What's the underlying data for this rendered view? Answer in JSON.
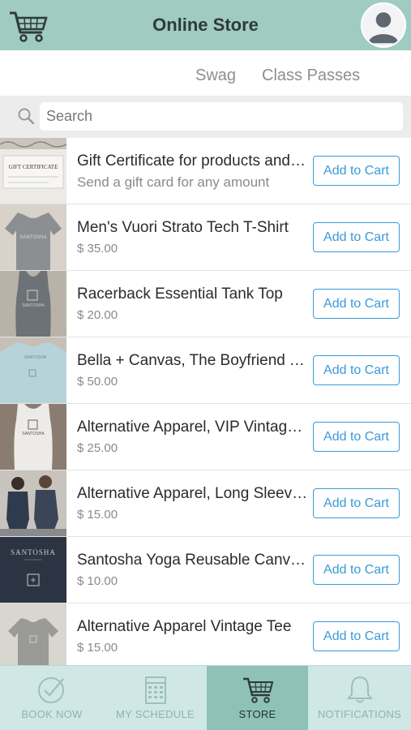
{
  "header": {
    "title": "Online Store",
    "cart_icon": "cart-icon",
    "avatar_icon": "user-avatar-icon"
  },
  "tabs": [
    {
      "label": "Swag"
    },
    {
      "label": "Class Passes"
    }
  ],
  "search": {
    "placeholder": "Search",
    "value": ""
  },
  "products": [
    {
      "name": "Gift Certificate for products and services",
      "subtitle": "Send a gift card for any amount",
      "button": "Add to Cart",
      "thumb_text": "GIFT CERTIFICATE"
    },
    {
      "name": "Men's Vuori Strato Tech T-Shirt",
      "subtitle": "$ 35.00",
      "button": "Add to Cart"
    },
    {
      "name": "Racerback Essential Tank Top",
      "subtitle": "$ 20.00",
      "button": "Add to Cart"
    },
    {
      "name": "Bella + Canvas, The Boyfriend Tee",
      "subtitle": "$ 50.00",
      "button": "Add to Cart"
    },
    {
      "name": "Alternative Apparel, VIP Vintage Tank",
      "subtitle": "$ 25.00",
      "button": "Add to Cart"
    },
    {
      "name": "Alternative Apparel, Long Sleeve Tee",
      "subtitle": "$ 15.00",
      "button": "Add to Cart"
    },
    {
      "name": "Santosha Yoga Reusable Canvas Bag",
      "subtitle": "$ 10.00",
      "button": "Add to Cart",
      "thumb_text": "SANTOSHA"
    },
    {
      "name": "Alternative Apparel Vintage Tee",
      "subtitle": "$ 15.00",
      "button": "Add to Cart"
    }
  ],
  "tabbar": [
    {
      "label": "BOOK NOW",
      "icon": "check-circle-icon",
      "active": false
    },
    {
      "label": "MY SCHEDULE",
      "icon": "calendar-icon",
      "active": false
    },
    {
      "label": "STORE",
      "icon": "cart-icon",
      "active": true
    },
    {
      "label": "NOTIFICATIONS",
      "icon": "bell-icon",
      "active": false
    }
  ],
  "colors": {
    "header": "#9fcbc1",
    "accent": "#3a9ad9",
    "tabbar": "#cfe8e5",
    "tabbar_active": "#8ec2b8"
  }
}
